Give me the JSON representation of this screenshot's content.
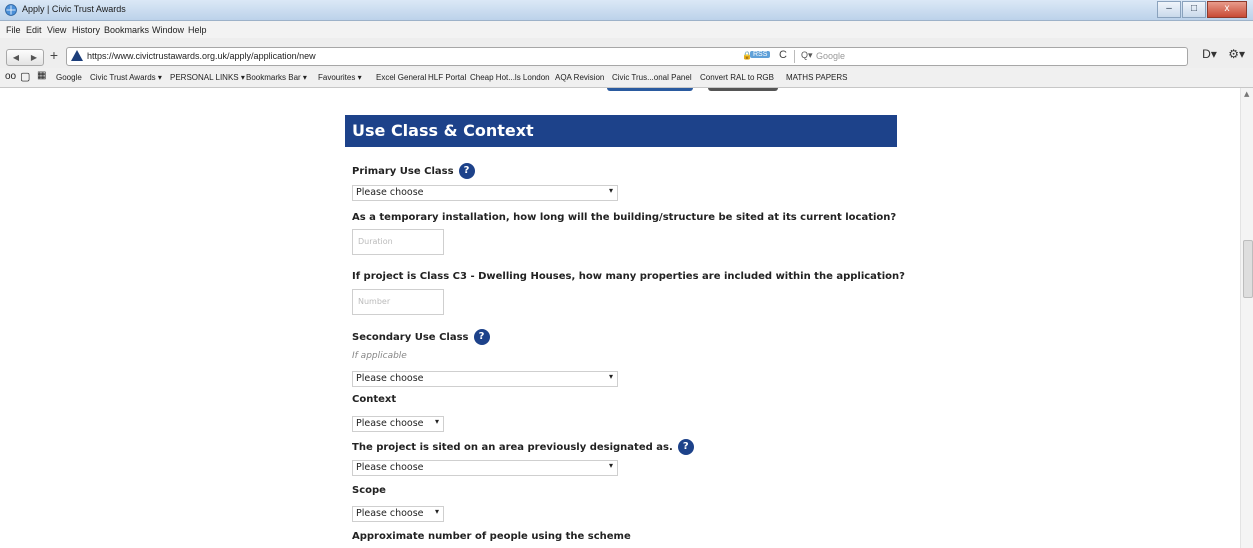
{
  "window": {
    "title": "Apply | Civic Trust Awards",
    "minimize": "–",
    "maximize": "□",
    "close": "x"
  },
  "menu": [
    "File",
    "Edit",
    "View",
    "History",
    "Bookmarks",
    "Window",
    "Help"
  ],
  "nav": {
    "back": "◀",
    "forward": "▶",
    "new_tab": "+",
    "url": "https://www.civictrustawards.org.uk/apply/application/new",
    "rss": "RSS",
    "reload": "C",
    "search_icon": "Q▾",
    "search_placeholder": "Google",
    "page_menu": "D▾",
    "tools_menu": "⚙▾"
  },
  "bookmarks": {
    "icons": [
      "reader-icon",
      "bookmarks-book-icon",
      "top-sites-grid-icon"
    ],
    "items": [
      "Google",
      "Civic Trust Awards ▾",
      "PERSONAL LINKS ▾",
      "Bookmarks Bar ▾",
      "Favourites ▾",
      "Excel General",
      "HLF Portal",
      "Cheap Hot...ls London",
      "AQA Revision",
      "Civic Trus...onal Panel",
      "Convert RAL to RGB",
      "MATHS PAPERS"
    ]
  },
  "form": {
    "section_title": "Use Class & Context",
    "help_glyph": "?",
    "primary_use_label": "Primary Use Class",
    "primary_use_value": "Please choose",
    "temporary_label": "As a temporary installation, how long will the building/structure be sited at its current location?",
    "duration_placeholder": "Duration",
    "dwelling_label": "If project is Class C3 - Dwelling Houses, how many properties are included within the application?",
    "number_placeholder": "Number",
    "secondary_use_label": "Secondary Use Class",
    "secondary_hint": "If applicable",
    "secondary_use_value": "Please choose",
    "context_label": "Context",
    "context_value": "Please choose",
    "designated_label": "The project is sited on an area previously designated as.",
    "designated_value": "Please choose",
    "scope_label": "Scope",
    "scope_value": "Please choose",
    "people_label": "Approximate number of people using the scheme",
    "dropdown_arrow": "▾"
  },
  "colors": {
    "header_blue": "#1d428a",
    "help_blue": "#1d428a"
  }
}
